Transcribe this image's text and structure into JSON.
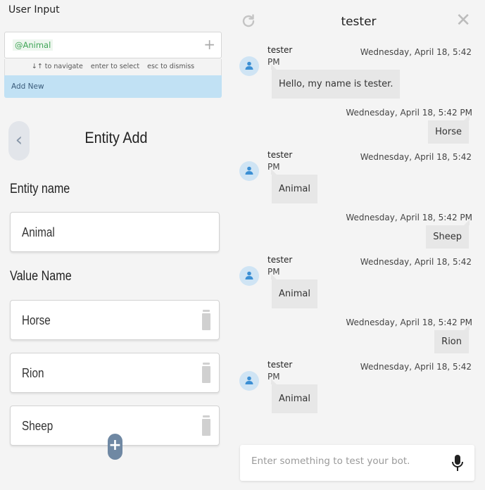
{
  "left": {
    "title": "User Input",
    "input": {
      "token": "@Animal",
      "plus": "+"
    },
    "hints": {
      "navigate": "↓↑ to navigate",
      "select": "enter to select",
      "dismiss": "esc to dismiss"
    },
    "suggestion": "Add New",
    "form": {
      "back": "‹",
      "title": "Entity Add",
      "entity_label": "Entity name",
      "entity_value": "Animal",
      "values_label": "Value Name",
      "values": [
        "Horse",
        "Rion",
        "Sheep"
      ],
      "add": "+"
    }
  },
  "chat": {
    "title": "tester",
    "close": "✕",
    "messages": [
      {
        "sender": "tester",
        "time": "Wednesday, April 18, 5:42",
        "pm": "PM",
        "text": "Hello, my name is tester."
      },
      {
        "time": "Wednesday, April 18, 5:42 PM",
        "text": "Horse"
      },
      {
        "sender": "tester",
        "time": "Wednesday, April 18, 5:42",
        "pm": "PM",
        "text": "Animal"
      },
      {
        "time": "Wednesday, April 18, 5:42 PM",
        "text": "Sheep"
      },
      {
        "sender": "tester",
        "time": "Wednesday, April 18, 5:42",
        "pm": "PM",
        "text": "Animal"
      },
      {
        "time": "Wednesday, April 18, 5:42 PM",
        "text": "Rion"
      },
      {
        "sender": "tester",
        "time": "Wednesday, April 18, 5:42",
        "pm": "PM",
        "text": "Animal"
      }
    ],
    "input_placeholder": "Enter something to test your bot."
  },
  "icons": {
    "refresh": "refresh-icon",
    "close": "close-icon",
    "mic": "mic-icon",
    "trash": "trash-icon",
    "avatar": "user-icon"
  },
  "colors": {
    "accent_blue": "#c1e1f4",
    "token_green": "#3fa556",
    "add_button": "#6f88a3"
  }
}
